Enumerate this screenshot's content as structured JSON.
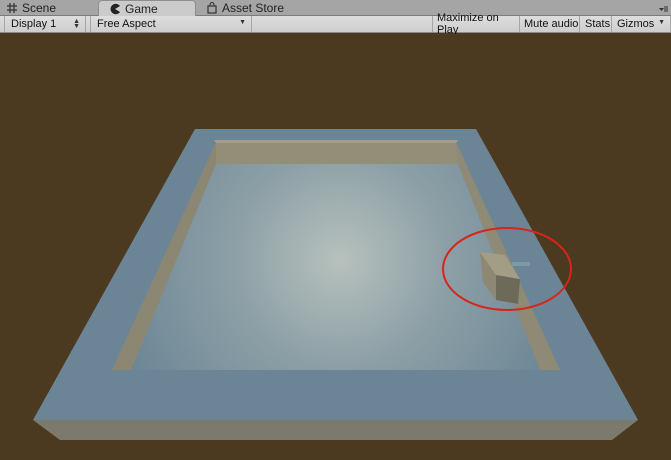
{
  "tabs": [
    {
      "label": "Scene",
      "icon": "grid-icon",
      "active": false
    },
    {
      "label": "Game",
      "icon": "pacman-icon",
      "active": true
    },
    {
      "label": "Asset Store",
      "icon": "shopping-bag-icon",
      "active": false
    }
  ],
  "toolbar": {
    "display": "Display 1",
    "aspect": "Free Aspect",
    "maximize": "Maximize on Play",
    "mute": "Mute audio",
    "stats": "Stats",
    "gizmos": "Gizmos"
  },
  "colors": {
    "background": "#4b3920",
    "floor": "#6e8797",
    "wall": "#8f8a77",
    "highlight_circle": "#d8251c"
  }
}
